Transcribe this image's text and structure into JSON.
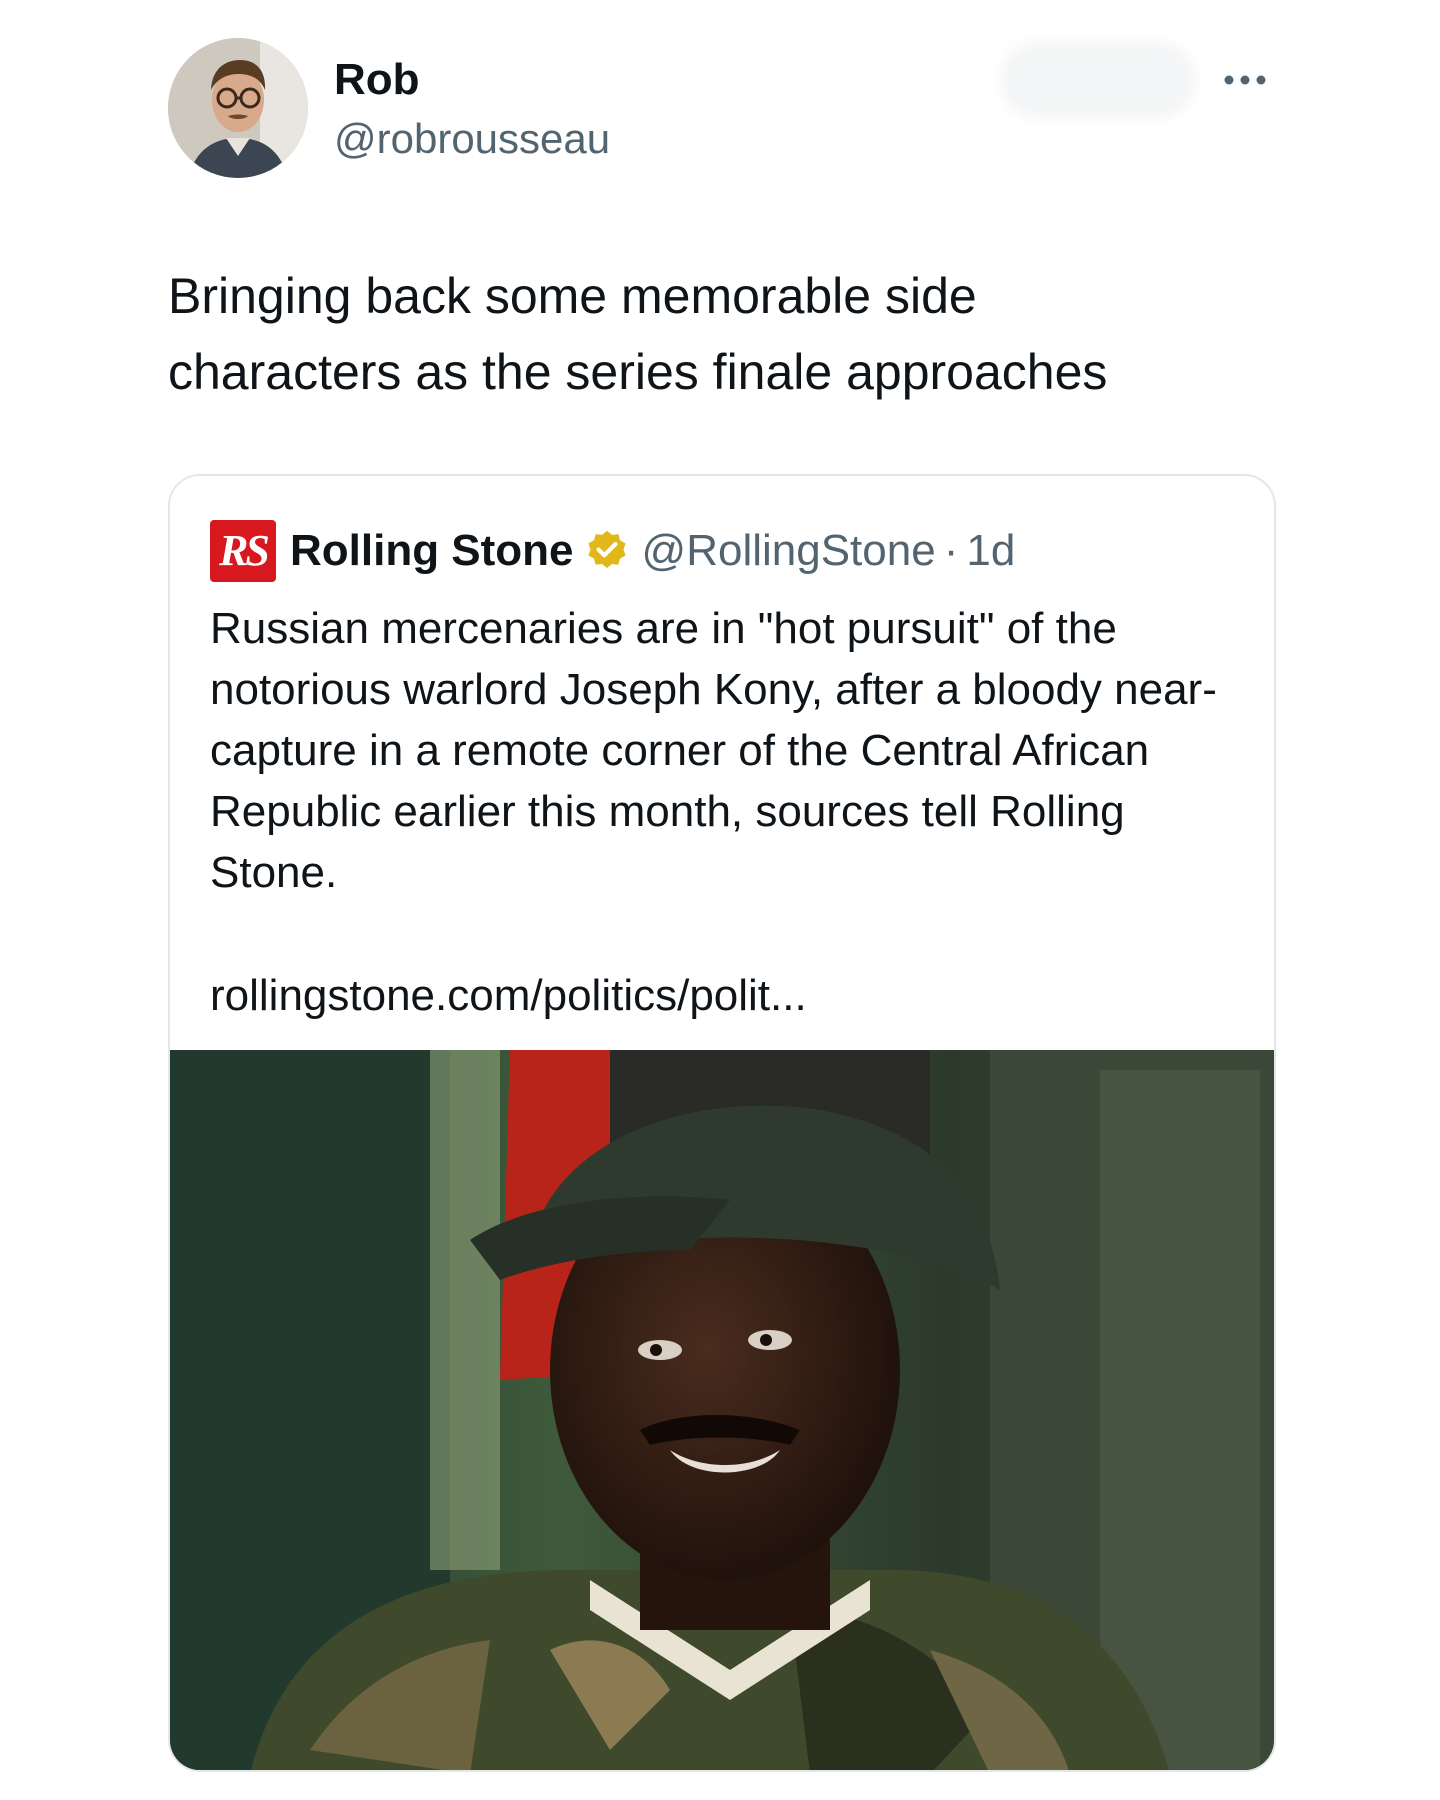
{
  "author": {
    "display_name": "Rob",
    "handle": "@robrousseau",
    "avatar_icon": "profile-photo"
  },
  "more_icon": "more-horizontal-icon",
  "tweet": {
    "text": "Bringing back some memorable side\ncharacters as the series finale approaches"
  },
  "quote": {
    "logo_text": "RS",
    "name": "Rolling Stone",
    "verified": true,
    "verified_color": "#e2b719",
    "handle": "@RollingStone",
    "separator": "·",
    "time": "1d",
    "text": "Russian mercenaries are in \"hot pursuit\" of the notorious warlord Joseph Kony, after a bloody near-capture in a remote corner of the Central African Republic earlier this month, sources tell Rolling Stone.",
    "link": "rollingstone.com/politics/polit...",
    "image_icon": "article-photo"
  },
  "colors": {
    "text_primary": "#0f1419",
    "text_secondary": "#536471",
    "border": "#e4e7ea",
    "brand_red": "#d7191f"
  }
}
